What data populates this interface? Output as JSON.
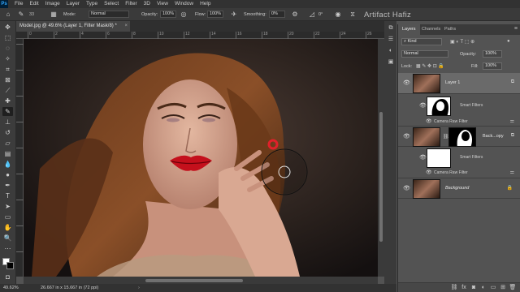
{
  "menu": {
    "items": [
      "File",
      "Edit",
      "Image",
      "Layer",
      "Type",
      "Select",
      "Filter",
      "3D",
      "View",
      "Window",
      "Help"
    ]
  },
  "options": {
    "mode_label": "Mode:",
    "mode_value": "Normal",
    "opacity_label": "Opacity:",
    "opacity_value": "100%",
    "flow_label": "Flow:",
    "flow_value": "100%",
    "smoothing_label": "Smoothing:",
    "smoothing_value": "0%",
    "brush_size": "33",
    "angle_value": "0°"
  },
  "watermark": "Artifact Hafiz",
  "document": {
    "tab_title": "Model.jpg @ 49.6% (Layer 1, Filter Mask/8) *",
    "close": "×"
  },
  "ruler_labels": [
    "0",
    "2",
    "4",
    "6",
    "8",
    "10",
    "12",
    "14",
    "16",
    "18",
    "20",
    "22",
    "24",
    "26"
  ],
  "status": {
    "zoom": "49.62%",
    "size": "26.667 in x 15.667 in (72 ppi)"
  },
  "layers_panel": {
    "tabs": [
      "Layers",
      "Channels",
      "Paths"
    ],
    "filter_kind": "Kind",
    "blend_mode": "Normal",
    "opacity_label": "Opacity:",
    "opacity_value": "100%",
    "lock_label": "Lock:",
    "fill_label": "Fill:",
    "fill_value": "100%",
    "layers": [
      {
        "name": "Layer 1",
        "smart_filters": "Smart Filters",
        "filter": "Camera Raw Filter"
      },
      {
        "name": "Back...opy",
        "smart_filters": "Smart Filters",
        "filter": "Camera Raw Filter"
      },
      {
        "name": "Background"
      }
    ]
  },
  "colors": {
    "accent_red": "#e0202a",
    "ui_dark": "#323232",
    "panel": "#535353"
  }
}
